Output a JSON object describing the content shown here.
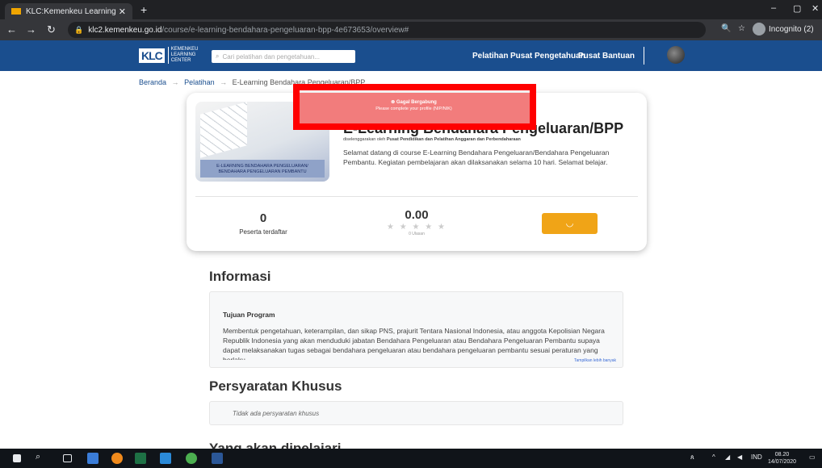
{
  "browser": {
    "tab_title": "KLC:Kemenkeu Learning Center",
    "tab_close": "✕",
    "new_tab": "+",
    "url_host": "klc2.kemenkeu.go.id",
    "url_path": "/course/e-learning-bendahara-pengeluaran-bpp-4e673653/overview#",
    "profile_label": "Incognito (2)",
    "window_controls": [
      "–",
      "▢",
      "✕"
    ]
  },
  "site": {
    "logo_mark": "KLC",
    "logo_lines": [
      "KEMENKEU",
      "LEARNING",
      "CENTER"
    ],
    "search_placeholder": "Cari pelatihan dan pengetahuan...",
    "nav": [
      "Pelatihan",
      "Pusat Pengetahuan",
      "Pusat Bantuan"
    ]
  },
  "breadcrumb": {
    "home": "Beranda",
    "section": "Pelatihan",
    "current": "E-Learning Bendahara Pengeluaran/BPP",
    "separator": "→"
  },
  "toast": {
    "title": "Gagal Bergabung",
    "message": "Please complete your profile (NIP/NIK)"
  },
  "course": {
    "thumb_caption_1": "E-LEARNING BENDAHARA PENGELUARAN/",
    "thumb_caption_2": "BENDAHARA PENGELUARAN PEMBANTU",
    "title": "E-Learning Bendahara Pengeluaran/BPP",
    "organizer_prefix": "diselenggarakan oleh",
    "organizer": "Pusat Pendidikan dan Pelatihan Anggaran dan Perbendaharaan",
    "description": "Selamat datang di course E-Learning Bendahara Pengeluaran/Bendahara Pengeluaran Pembantu. Kegiatan pembelajaran akan dilaksanakan selama 10 hari. Selamat belajar.",
    "participants": "0",
    "participants_label": "Peserta terdaftar",
    "rating": "0.00",
    "stars": "★ ★ ★ ★ ★",
    "reviews": "0 Ulasan",
    "join_spinner": "◡"
  },
  "info": {
    "heading": "Informasi",
    "label": "Tujuan Program",
    "body": "Membentuk pengetahuan, keterampilan, dan sikap PNS, prajurit Tentara Nasional Indonesia, atau anggota Kepolisian Negara Republik Indonesia yang akan menduduki jabatan Bendahara Pengeluaran atau Bendahara Pengeluaran Pembantu supaya dapat melaksanakan tugas sebagai bendahara pengeluaran atau bendahara pengeluaran pembantu sesuai peraturan yang berlaku.",
    "more": "Tampilkan lebih banyak"
  },
  "requirements": {
    "heading": "Persyaratan Khusus",
    "empty": "Tidak ada persyaratan khusus"
  },
  "next_section": "Yang akan dipelajari",
  "taskbar": {
    "language": "IND",
    "time": "08.20",
    "date": "14/07/2020"
  }
}
